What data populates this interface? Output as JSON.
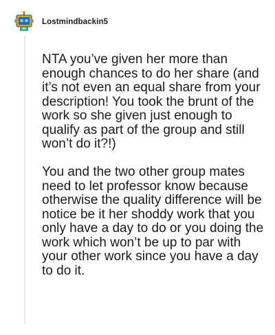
{
  "comment": {
    "author": "Lostmindbackin5",
    "avatar_icon": "robot-avatar-icon",
    "paragraphs": [
      "NTA you’ve given her more than enough chances to do her share (and it’s not even an equal share from your description! You took the brunt of the work so she given just enough to qualify as part of the group and still won’t do it?!)",
      "You and the two other group mates need to let professor know because otherwise the quality difference will be notice be it her shoddy work that you only have a day to do or you doing the work which won’t be up to par with your other work since you have a day to do it."
    ]
  }
}
